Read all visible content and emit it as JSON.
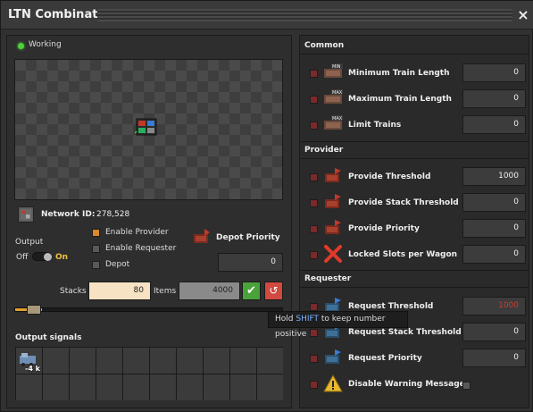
{
  "window": {
    "title": "LTN Combinator",
    "close_icon": "×"
  },
  "status": {
    "text": "Working",
    "color": "#4cd137"
  },
  "network": {
    "label": "Network ID:",
    "value": "278,528"
  },
  "output": {
    "label": "Output",
    "off_label": "Off",
    "on_label": "On",
    "state": "on"
  },
  "checkboxes": {
    "provider": {
      "label": "Enable Provider",
      "checked": true
    },
    "requester": {
      "label": "Enable Requester",
      "checked": false
    },
    "depot": {
      "label": "Depot",
      "checked": false
    }
  },
  "depot_priority": {
    "label": "Depot Priority",
    "value": "0"
  },
  "stacks": {
    "label": "Stacks",
    "value": "80",
    "items_label": "Items",
    "items_value": "4000",
    "confirm_icon": "✔",
    "reset_icon": "↺",
    "slider_fraction": 0.1
  },
  "output_signals": {
    "label": "Output signals",
    "slots": [
      {
        "icon": "locomotive-icon",
        "count": "-4 k"
      }
    ]
  },
  "tooltip": {
    "prefix": "Hold ",
    "key": "SHIFT",
    "suffix": " to keep number positive"
  },
  "common": {
    "label": "Common",
    "rows": [
      {
        "label": "Minimum Train Length",
        "value": "0",
        "badge": "MIN"
      },
      {
        "label": "Maximum Train Length",
        "value": "0",
        "badge": "MAX"
      },
      {
        "label": "Limit Trains",
        "value": "0",
        "badge": "MAX"
      }
    ]
  },
  "provider": {
    "label": "Provider",
    "rows": [
      {
        "label": "Provide Threshold",
        "value": "1000"
      },
      {
        "label": "Provide Stack Threshold",
        "value": "0"
      },
      {
        "label": "Provide Priority",
        "value": "0"
      },
      {
        "label": "Locked Slots per Wagon",
        "value": "0"
      }
    ]
  },
  "requester": {
    "label": "Requester",
    "rows": [
      {
        "label": "Request Threshold",
        "value": "1000"
      },
      {
        "label": "Request Stack Threshold",
        "value": "0"
      },
      {
        "label": "Request Priority",
        "value": "0"
      },
      {
        "label": "Disable Warning Messages",
        "value": ""
      }
    ]
  }
}
